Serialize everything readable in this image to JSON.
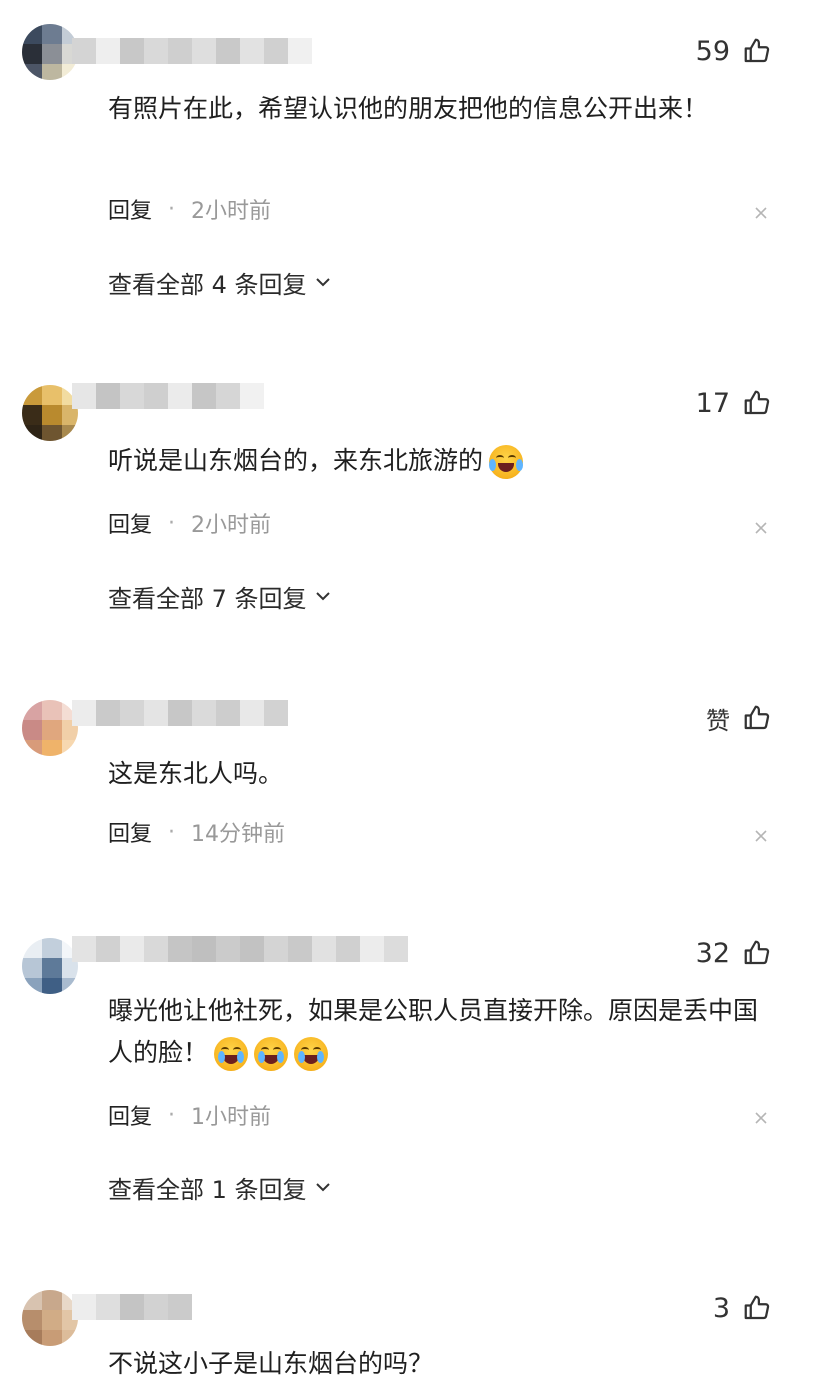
{
  "comments": [
    {
      "likes": "59",
      "text": "有照片在此，希望认识他的朋友把他的信息公开出来！",
      "reply_label": "回复",
      "separator": "·",
      "time": "2小时前",
      "view_replies": "查看全部 4 条回复"
    },
    {
      "likes": "17",
      "text": "听说是山东烟台的，来东北旅游的",
      "emoji": "laughing-crying-emoji",
      "reply_label": "回复",
      "separator": "·",
      "time": "2小时前",
      "view_replies": "查看全部 7 条回复"
    },
    {
      "likes": "赞",
      "text": "这是东北人吗。",
      "reply_label": "回复",
      "separator": "·",
      "time": "14分钟前"
    },
    {
      "likes": "32",
      "text": "曝光他让他社死，如果是公职人员直接开除。原因是丢中国人的脸！",
      "emoji": "crying-emoji",
      "reply_label": "回复",
      "separator": "·",
      "time": "1小时前",
      "view_replies": "查看全部 1 条回复"
    },
    {
      "likes": "3",
      "text": "不说这小子是山东烟台的吗？"
    }
  ],
  "colors": {
    "background": "#ffffff",
    "text": "#1f1f1f",
    "meta": "#999999",
    "icon": "#333333"
  }
}
